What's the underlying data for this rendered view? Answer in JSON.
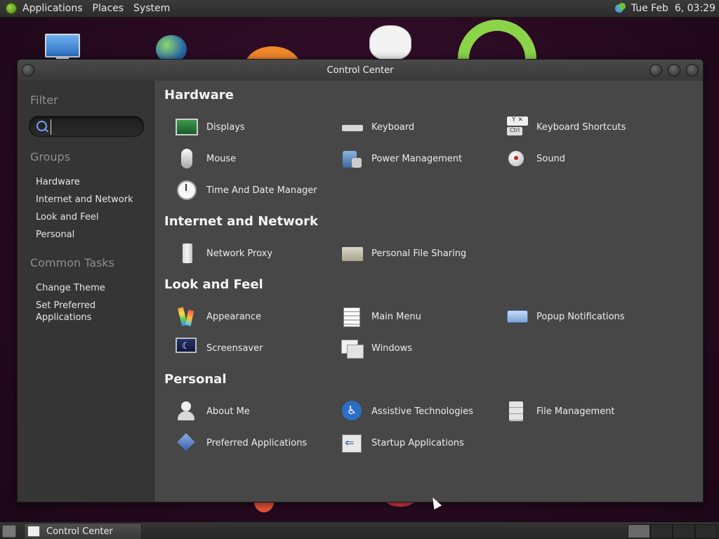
{
  "top_panel": {
    "menus": [
      "Applications",
      "Places",
      "System"
    ],
    "clock": "Tue Feb  6, 03:29"
  },
  "window": {
    "title": "Control Center"
  },
  "sidebar": {
    "filter_header": "Filter",
    "search_placeholder": "",
    "groups_header": "Groups",
    "groups": [
      "Hardware",
      "Internet and Network",
      "Look and Feel",
      "Personal"
    ],
    "tasks_header": "Common Tasks",
    "tasks": [
      "Change Theme",
      "Set Preferred Applications"
    ]
  },
  "sections": [
    {
      "title": "Hardware",
      "items": [
        {
          "label": "Displays",
          "icon": "display-icon"
        },
        {
          "label": "Keyboard",
          "icon": "keyboard-icon"
        },
        {
          "label": "Keyboard Shortcuts",
          "icon": "keyboard-shortcuts-icon"
        },
        {
          "label": "Mouse",
          "icon": "mouse-icon"
        },
        {
          "label": "Power Management",
          "icon": "power-management-icon"
        },
        {
          "label": "Sound",
          "icon": "sound-icon"
        },
        {
          "label": "Time And Date Manager",
          "icon": "clock-icon"
        }
      ]
    },
    {
      "title": "Internet and Network",
      "items": [
        {
          "label": "Network Proxy",
          "icon": "network-proxy-icon"
        },
        {
          "label": "Personal File Sharing",
          "icon": "folder-share-icon"
        }
      ]
    },
    {
      "title": "Look and Feel",
      "items": [
        {
          "label": "Appearance",
          "icon": "appearance-icon"
        },
        {
          "label": "Main Menu",
          "icon": "main-menu-icon"
        },
        {
          "label": "Popup Notifications",
          "icon": "popup-notifications-icon"
        },
        {
          "label": "Screensaver",
          "icon": "screensaver-icon"
        },
        {
          "label": "Windows",
          "icon": "windows-icon"
        }
      ]
    },
    {
      "title": "Personal",
      "items": [
        {
          "label": "About Me",
          "icon": "about-me-icon"
        },
        {
          "label": "Assistive Technologies",
          "icon": "accessibility-icon"
        },
        {
          "label": "File Management",
          "icon": "file-management-icon"
        },
        {
          "label": "Preferred Applications",
          "icon": "preferred-applications-icon"
        },
        {
          "label": "Startup Applications",
          "icon": "startup-applications-icon"
        }
      ]
    }
  ],
  "bottom_panel": {
    "task_label": "Control Center"
  }
}
